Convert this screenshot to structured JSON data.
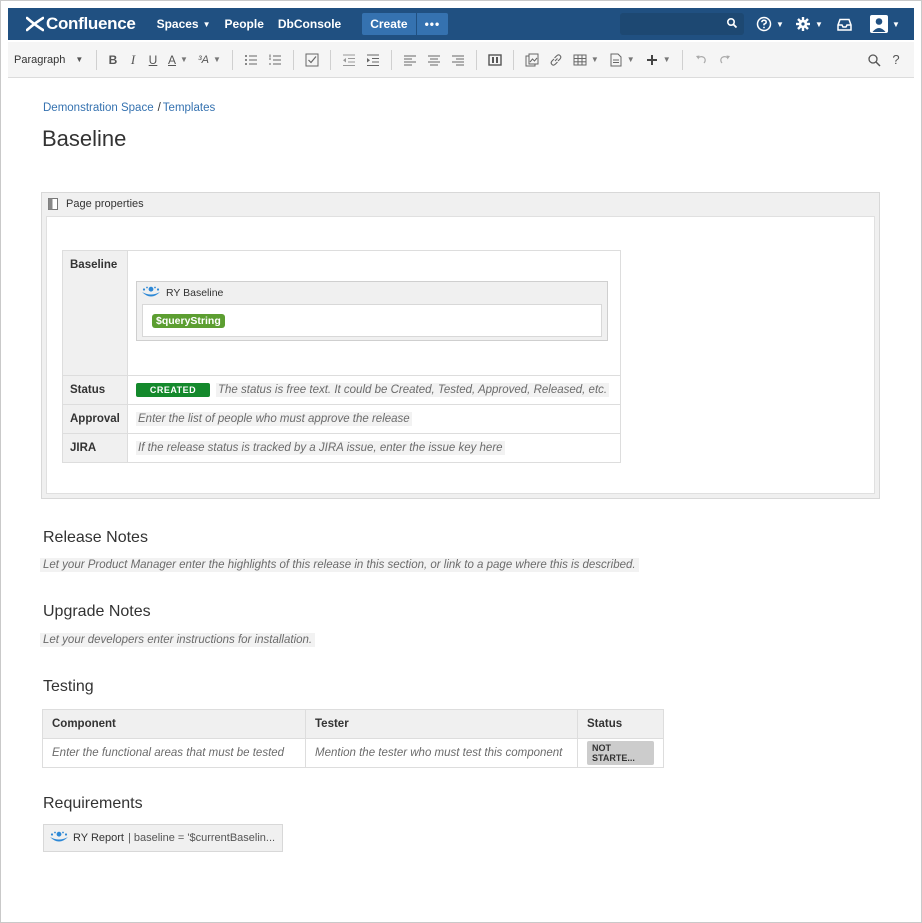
{
  "nav": {
    "logo_text": "Confluence",
    "spaces": "Spaces",
    "people": "People",
    "dbconsole": "DbConsole",
    "create": "Create",
    "more": "•••",
    "search_placeholder": ""
  },
  "toolbar": {
    "paragraph": "Paragraph",
    "bold": "B",
    "italic": "I",
    "underline": "U",
    "text_color": "A",
    "more_format": "³A"
  },
  "breadcrumb": {
    "space": "Demonstration Space",
    "templates": "Templates"
  },
  "page_title": "Baseline",
  "page_properties": {
    "title": "Page properties",
    "rows": {
      "baseline_label": "Baseline",
      "ry_baseline_title": "RY Baseline",
      "query_variable": "$queryString",
      "status_label": "Status",
      "status_lozenge": "CREATED",
      "status_text": "The status is free text. It could be Created, Tested, Approved, Released, etc.",
      "approval_label": "Approval",
      "approval_text": "Enter the list of people who must approve the release",
      "jira_label": "JIRA",
      "jira_text": "If the release status is tracked by a JIRA issue, enter the issue key here"
    }
  },
  "sections": {
    "release_notes_title": "Release Notes",
    "release_notes_text": "Let your Product Manager enter the highlights of this release in this section, or link to a page where this is described.",
    "upgrade_notes_title": "Upgrade Notes",
    "upgrade_notes_text": "Let your developers enter instructions for installation.",
    "testing_title": "Testing",
    "requirements_title": "Requirements"
  },
  "testing_table": {
    "headers": [
      "Component",
      "Tester",
      "Status"
    ],
    "row": {
      "component": "Enter the functional areas that must be tested",
      "tester": "Mention the tester who must test this component",
      "status": "NOT STARTE..."
    }
  },
  "report": {
    "title": "RY Report",
    "query": "| baseline = '$currentBaselin..."
  },
  "colors": {
    "nav_bg": "#205081",
    "create_bg": "#3572b0",
    "link": "#3572b0",
    "lozenge_created": "#14892c",
    "variable_tag": "#5c9e31"
  }
}
